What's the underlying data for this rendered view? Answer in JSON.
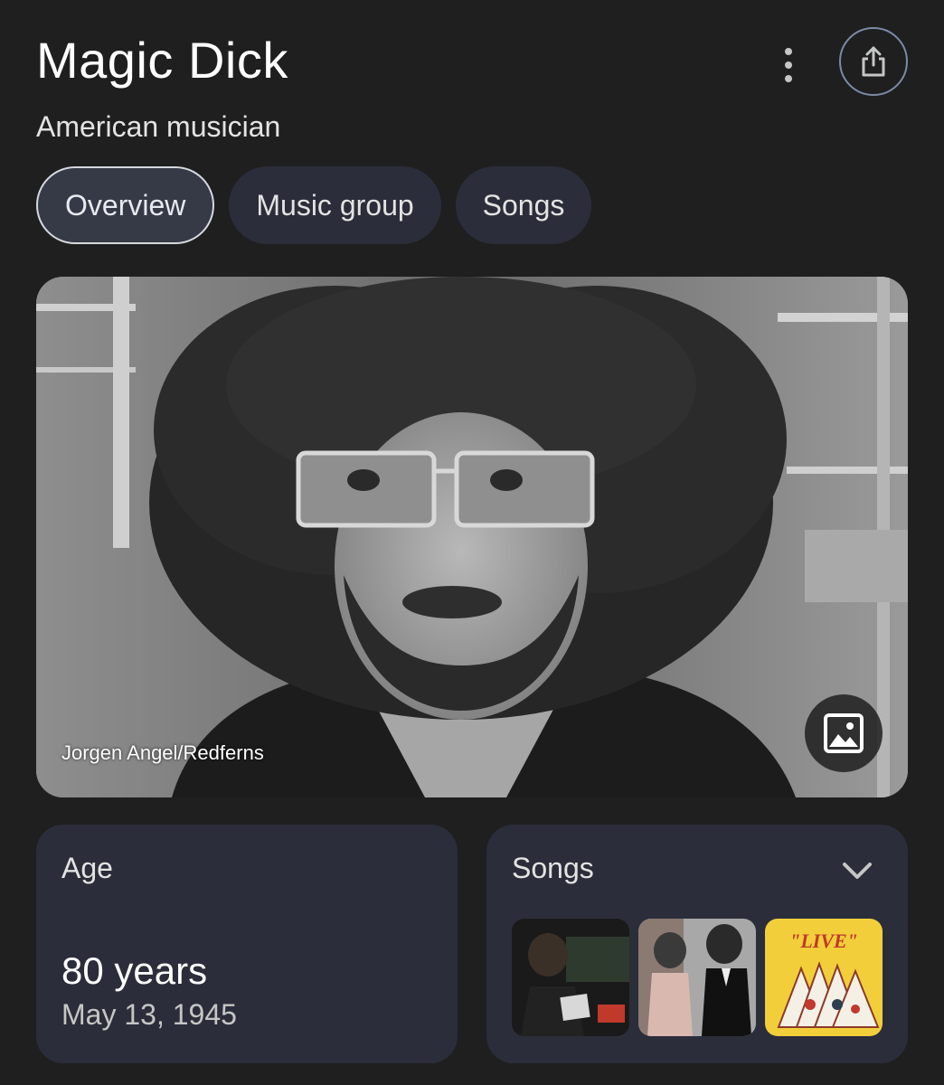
{
  "entity": {
    "title": "Magic Dick",
    "subtitle": "American musician"
  },
  "header_icons": {
    "menu": "more-vert-icon",
    "share": "share-icon"
  },
  "tabs": [
    {
      "label": "Overview",
      "active": true
    },
    {
      "label": "Music group",
      "active": false
    },
    {
      "label": "Songs",
      "active": false
    }
  ],
  "photo": {
    "credit": "Jorgen Angel/Redferns",
    "gallery_icon": "image-icon"
  },
  "age_card": {
    "label": "Age",
    "value": "80 years",
    "birth_date": "May 13, 1945"
  },
  "songs_card": {
    "label": "Songs",
    "expand_icon": "chevron-down-icon",
    "thumbnails": [
      {
        "name": "song-thumbnail-1"
      },
      {
        "name": "song-thumbnail-2"
      },
      {
        "name": "song-thumbnail-3",
        "text": "\"LIVE\""
      }
    ]
  },
  "colors": {
    "background": "#1f1f1f",
    "card": "#2b2d3a",
    "active_tab_border": "#d6d8df",
    "share_ring": "#7c8aa8"
  }
}
